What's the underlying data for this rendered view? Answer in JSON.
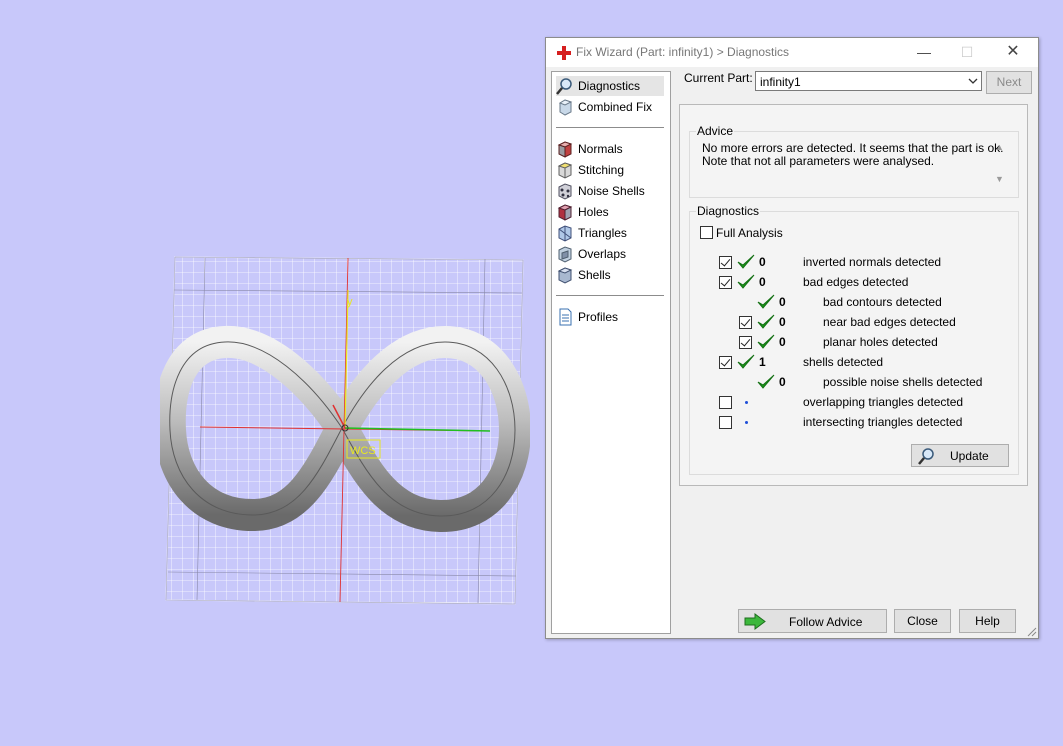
{
  "window": {
    "title": "Fix Wizard (Part: infinity1) > Diagnostics",
    "min_glyph": "—",
    "max_glyph": "☐",
    "close_glyph": "✕"
  },
  "nav": {
    "items": [
      {
        "label": "Diagnostics",
        "icon": "magnifier-icon"
      },
      {
        "label": "Combined Fix",
        "icon": "cube-icon"
      },
      {
        "label": "Normals",
        "icon": "cube-red-icon"
      },
      {
        "label": "Stitching",
        "icon": "cube-stitch-icon"
      },
      {
        "label": "Noise Shells",
        "icon": "cube-dots-icon"
      },
      {
        "label": "Holes",
        "icon": "cube-hole-icon"
      },
      {
        "label": "Triangles",
        "icon": "cube-blue-icon"
      },
      {
        "label": "Overlaps",
        "icon": "cube-overlap-icon"
      },
      {
        "label": "Shells",
        "icon": "cube-shell-icon"
      },
      {
        "label": "Profiles",
        "icon": "document-icon"
      }
    ],
    "selected": "Diagnostics"
  },
  "part": {
    "label": "Current Part:",
    "value": "infinity1",
    "next_label": "Next"
  },
  "advice": {
    "title": "Advice",
    "line1": "No more errors are detected. It seems that the part is ok.",
    "line2": "Note that not all parameters were analysed."
  },
  "diagnostics": {
    "title": "Diagnostics",
    "full_analysis_label": "Full Analysis",
    "full_analysis_checked": false,
    "rows": [
      {
        "checkbox": true,
        "checked": true,
        "status": "ok",
        "count": "0",
        "text": "inverted normals detected",
        "indent": 0
      },
      {
        "checkbox": true,
        "checked": true,
        "status": "ok",
        "count": "0",
        "text": "bad edges detected",
        "indent": 0
      },
      {
        "checkbox": false,
        "checked": false,
        "status": "ok",
        "count": "0",
        "text": "bad contours detected",
        "indent": 1
      },
      {
        "checkbox": true,
        "checked": true,
        "status": "ok",
        "count": "0",
        "text": "near bad edges detected",
        "indent": 1
      },
      {
        "checkbox": true,
        "checked": true,
        "status": "ok",
        "count": "0",
        "text": "planar holes detected",
        "indent": 1
      },
      {
        "checkbox": true,
        "checked": true,
        "status": "ok",
        "count": "1",
        "text": "shells detected",
        "indent": 0
      },
      {
        "checkbox": false,
        "checked": false,
        "status": "ok",
        "count": "0",
        "text": "possible noise shells detected",
        "indent": 1
      },
      {
        "checkbox": true,
        "checked": false,
        "status": "not-analysed",
        "count": "",
        "text": "overlapping triangles detected",
        "indent": 0
      },
      {
        "checkbox": true,
        "checked": false,
        "status": "not-analysed",
        "count": "",
        "text": "intersecting triangles detected",
        "indent": 0
      }
    ],
    "update_label": "Update"
  },
  "footer": {
    "follow_advice_label": "Follow Advice",
    "close_label": "Close",
    "help_label": "Help"
  },
  "viewport": {
    "axis_y_label": "y",
    "wcs_label": "WCS",
    "colors": {
      "background": "#c8c8fa",
      "grid": "#ffffff",
      "x_axis": "#e03030",
      "y_axis": "#e8e820",
      "z_axis": "#20c020"
    }
  }
}
